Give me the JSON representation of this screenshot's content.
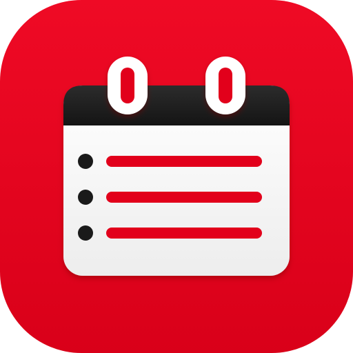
{
  "icon": {
    "name": "calendar-list-icon",
    "colors": {
      "background": "#E2001B",
      "header": "#1E1E1E",
      "paper": "#F6F6F6",
      "ring_face": "#FFFFFF",
      "line": "#E2001B",
      "bullet": "#1A1A1A"
    },
    "list_item_count": 3
  }
}
